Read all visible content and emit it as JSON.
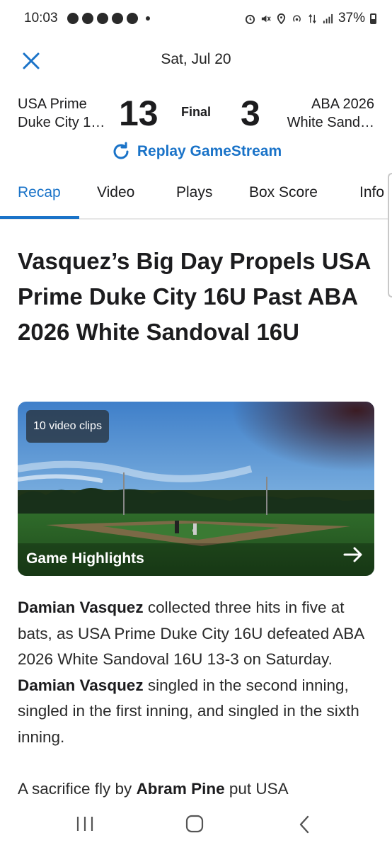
{
  "status_bar": {
    "time": "10:03",
    "battery": "37%",
    "left_icons": [
      "snapchat-icon",
      "messenger-icon",
      "messenger-icon",
      "snapchat-icon",
      "chat-icon",
      "dot"
    ],
    "right_icons": [
      "alarm-icon",
      "mute-icon",
      "location-icon",
      "hotspot-icon",
      "data-icon",
      "signal-icon",
      "battery-icon"
    ]
  },
  "header": {
    "date": "Sat, Jul 20",
    "close_icon": "close-icon"
  },
  "score": {
    "home_line1": "USA Prime",
    "home_line2": "Duke City 1…",
    "home_score": "13",
    "status": "Final",
    "away_score": "3",
    "away_line1": "ABA 2026",
    "away_line2": "White Sand…"
  },
  "replay": {
    "label": "Replay GameStream",
    "icon": "refresh-icon"
  },
  "tabs": [
    {
      "label": "Recap",
      "active": true
    },
    {
      "label": "Video",
      "active": false
    },
    {
      "label": "Plays",
      "active": false
    },
    {
      "label": "Box Score",
      "active": false
    },
    {
      "label": "Info",
      "active": false
    }
  ],
  "article": {
    "headline": "Vasquez’s Big Day Propels USA Prime Duke City 16U Past ABA 2026 White Sandoval 16U",
    "video": {
      "clips_badge": "10 video clips",
      "label": "Game Highlights",
      "arrow_icon": "arrow-right-icon"
    },
    "para1": {
      "b1": "Damian Vasquez",
      "t1": " collected three hits in five at bats, as USA Prime Duke City 16U defeated ABA 2026 White Sandoval 16U 13-3 on Saturday. ",
      "b2": "Damian Vasquez",
      "t2": " singled in the second inning, singled in the first inning, and singled in the sixth inning."
    },
    "para2": {
      "t1": "A sacrifice fly by ",
      "b1": "Abram Pine",
      "t2": " put USA"
    }
  },
  "colors": {
    "accent": "#1a73c8",
    "text": "#1c1c1e",
    "divider": "#e6e6e6"
  }
}
